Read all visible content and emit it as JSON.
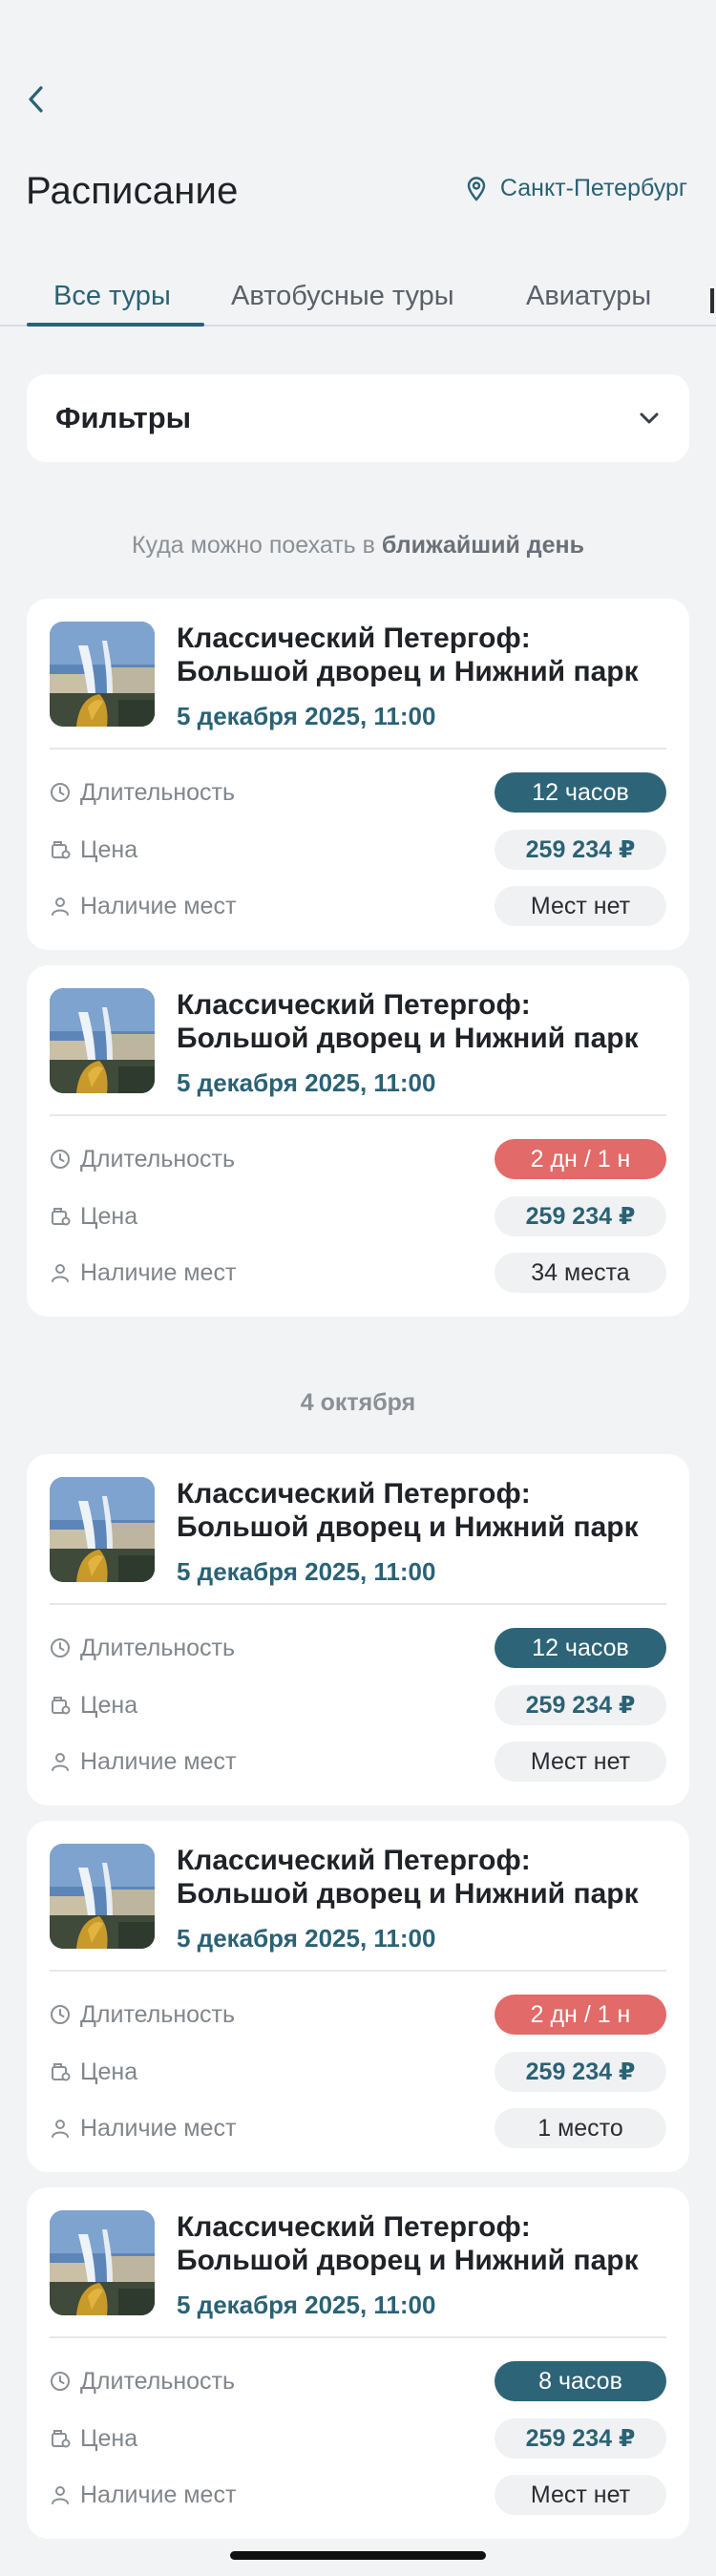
{
  "header": {
    "back_icon": "chevron-left-icon",
    "title": "Расписание",
    "city": "Санкт-Петербург",
    "city_icon": "location-pin-icon"
  },
  "tabs": [
    {
      "label": "Все туры",
      "active": true
    },
    {
      "label": "Автобусные туры",
      "active": false
    },
    {
      "label": "Авиатуры",
      "active": false
    }
  ],
  "filters": {
    "label": "Фильтры",
    "icon": "chevron-down-icon"
  },
  "sections": [
    {
      "label_prefix": "Куда можно поехать в ",
      "label_bold": "ближайший день"
    },
    {
      "label": "4 октября"
    }
  ],
  "row_labels": {
    "duration": "Длительность",
    "price": "Цена",
    "seats": "Наличие мест"
  },
  "cards": [
    {
      "title_line1": "Классический Петергоф:",
      "title_line2": "Большой дворец и Нижний парк",
      "date": "5 декабря 2025, 11:00",
      "duration": "12 часов",
      "duration_style": "teal",
      "price": "259 234 ₽",
      "seats": "Мест нет"
    },
    {
      "title_line1": "Классический Петергоф:",
      "title_line2": "Большой дворец и Нижний парк",
      "date": "5 декабря 2025, 11:00",
      "duration": "2 дн / 1 н",
      "duration_style": "red",
      "price": "259 234 ₽",
      "seats": "34 места"
    },
    {
      "title_line1": "Классический Петергоф:",
      "title_line2": "Большой дворец и Нижний парк",
      "date": "5 декабря 2025, 11:00",
      "duration": "12 часов",
      "duration_style": "teal",
      "price": "259 234 ₽",
      "seats": "Мест нет"
    },
    {
      "title_line1": "Классический Петергоф:",
      "title_line2": "Большой дворец и Нижний парк",
      "date": "5 декабря 2025, 11:00",
      "duration": "2 дн / 1 н",
      "duration_style": "red",
      "price": "259 234 ₽",
      "seats": "1 место"
    },
    {
      "title_line1": "Классический Петергоф:",
      "title_line2": "Большой дворец и Нижний парк",
      "date": "5 декабря 2025, 11:00",
      "duration": "8 часов",
      "duration_style": "teal",
      "price": "259 234 ₽",
      "seats": "Мест нет"
    }
  ],
  "colors": {
    "accent": "#2a6275",
    "teal_pill": "#2e6478",
    "red_pill": "#e26a68",
    "background": "#f2f3f5"
  }
}
